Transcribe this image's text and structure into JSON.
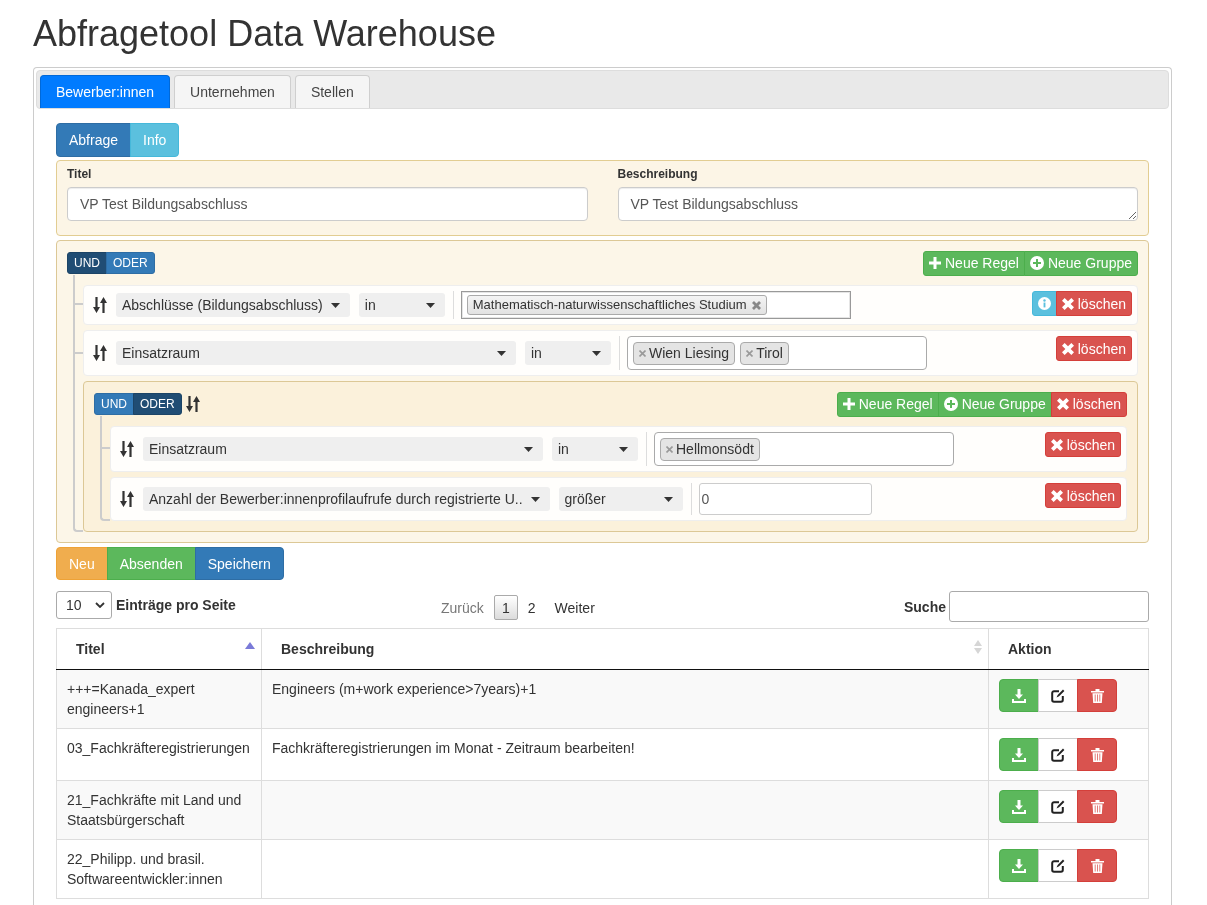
{
  "page_title": "Abfragetool Data Warehouse",
  "tabs": [
    {
      "label": "Bewerber:innen",
      "selected": true
    },
    {
      "label": "Unternehmen",
      "selected": false
    },
    {
      "label": "Stellen",
      "selected": false
    }
  ],
  "view_toggle": [
    {
      "label": "Abfrage",
      "selected": true
    },
    {
      "label": "Info",
      "selected": false
    }
  ],
  "query_form": {
    "fields": [
      {
        "kind": "input",
        "label": "Titel",
        "value": "VP Test Bildungsabschluss"
      },
      {
        "kind": "textarea",
        "label": "Beschreibung",
        "value": "VP Test Bildungsabschluss"
      }
    ]
  },
  "query_builder": {
    "conditions": [
      {
        "label": "UND",
        "selected": true
      },
      {
        "label": "ODER",
        "selected": false
      }
    ],
    "buttons": [
      {
        "kind": "add_rule",
        "label": "Neue Regel"
      },
      {
        "kind": "add_group",
        "label": "Neue Gruppe"
      }
    ],
    "children": [
      {
        "kind": "rule",
        "field": "Abschlüsse (Bildungsabschluss)",
        "operator": "in",
        "value": {
          "kind": "chosen",
          "tags": [
            "Mathematisch-naturwissenschaftliches Studium"
          ]
        },
        "buttons": [
          {
            "kind": "info"
          },
          {
            "kind": "delete",
            "label": "löschen"
          }
        ]
      },
      {
        "kind": "rule",
        "field": "Einsatzraum",
        "operator": "in",
        "value": {
          "kind": "tokens",
          "tags": [
            "Wien Liesing",
            "Tirol"
          ]
        },
        "buttons": [
          {
            "kind": "delete",
            "label": "löschen"
          }
        ]
      },
      {
        "kind": "group",
        "conditions": [
          {
            "label": "UND",
            "selected": false
          },
          {
            "label": "ODER",
            "selected": true
          }
        ],
        "buttons": [
          {
            "kind": "add_rule",
            "label": "Neue Regel"
          },
          {
            "kind": "add_group",
            "label": "Neue Gruppe"
          },
          {
            "kind": "delete",
            "label": "löschen"
          }
        ],
        "children": [
          {
            "kind": "rule",
            "field": "Einsatzraum",
            "operator": "in",
            "value": {
              "kind": "tokens",
              "tags": [
                "Hellmonsödt"
              ]
            },
            "buttons": [
              {
                "kind": "delete",
                "label": "löschen"
              }
            ]
          },
          {
            "kind": "rule",
            "field": "Anzahl der Bewerber:innenprofilaufrufe durch registrierte U..",
            "operator": "größer",
            "value": {
              "kind": "number",
              "text": "0"
            },
            "buttons": [
              {
                "kind": "delete",
                "label": "löschen"
              }
            ]
          }
        ]
      }
    ]
  },
  "form_buttons": [
    {
      "kind": "new",
      "label": "Neu"
    },
    {
      "kind": "submit",
      "label": "Absenden"
    },
    {
      "kind": "save",
      "label": "Speichern"
    }
  ],
  "table_controls": {
    "page_length": {
      "value": "10",
      "label": "Einträge pro Seite"
    },
    "pagination": {
      "previous": {
        "label": "Zurück",
        "disabled": true
      },
      "pages": [
        {
          "label": "1",
          "selected": true
        },
        {
          "label": "2",
          "selected": false
        }
      ],
      "next": {
        "label": "Weiter",
        "disabled": false
      }
    },
    "search": {
      "label": "Suche"
    }
  },
  "table": {
    "columns": [
      {
        "label": "Titel",
        "sortable": true,
        "sorted": true
      },
      {
        "label": "Beschreibung",
        "sortable": true,
        "sorted": false
      },
      {
        "label": "Aktion",
        "sortable": false
      }
    ],
    "row_actions": [
      {
        "kind": "download"
      },
      {
        "kind": "edit"
      },
      {
        "kind": "delete"
      }
    ],
    "rows": [
      {
        "titel": "+++=Kanada_expert engineers+1",
        "beschreibung": "Engineers (m+work experience>7years)+1"
      },
      {
        "titel": "03_Fachkräfteregistrierungen",
        "beschreibung": "Fachkräfteregistrierungen im Monat - Zeitraum bearbeiten!"
      },
      {
        "titel": "21_Fachkräfte mit Land und Staatsbürgerschaft"
      },
      {
        "titel": "22_Philipp. und brasil. Softwareentwickler:innen"
      }
    ]
  }
}
